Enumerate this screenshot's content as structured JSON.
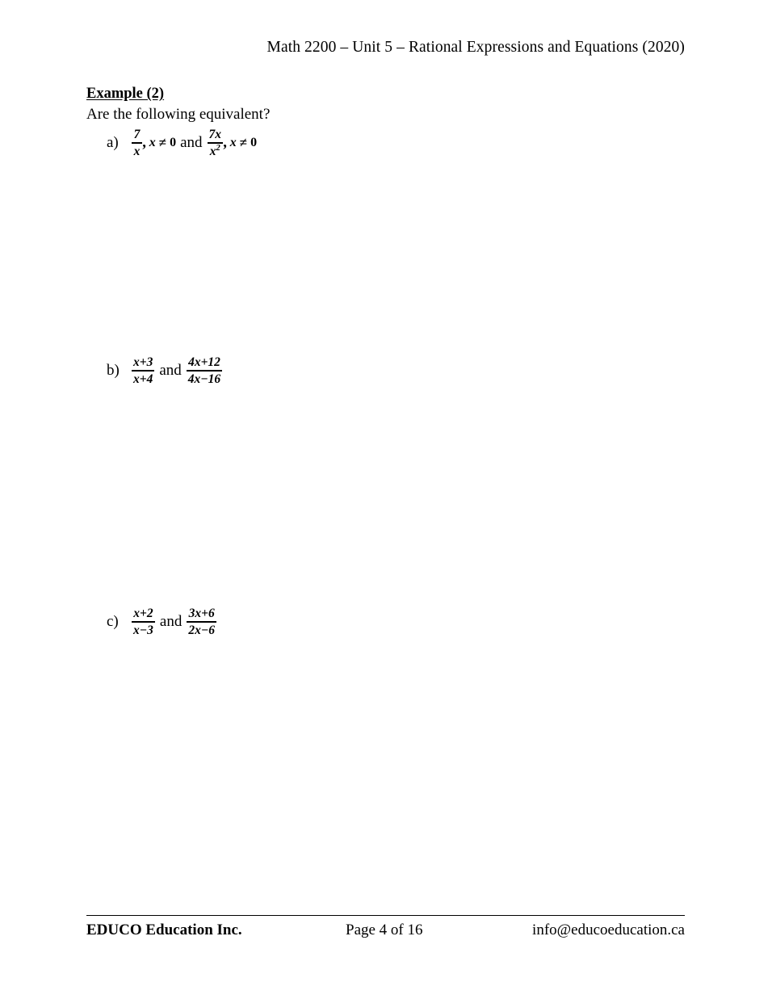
{
  "document": {
    "running_header": "Math 2200 – Unit 5 – Rational Expressions and Equations (2020)",
    "example_heading": "Example (2)",
    "prompt": "Are the following equivalent?"
  },
  "problems": [
    {
      "label": "a)",
      "text": "7/x, x ≠ 0 and 7x/x², x ≠ 0",
      "left": {
        "numerator": "7",
        "denominator": "x",
        "restriction_var": "x",
        "restriction_rel": "≠",
        "restriction_value": "0"
      },
      "connector": "and",
      "right": {
        "numerator": "7x",
        "denominator_base": "x",
        "denominator_exponent": "2",
        "restriction_var": "x",
        "restriction_rel": "≠",
        "restriction_value": "0"
      },
      "comma": ","
    },
    {
      "label": "b)",
      "text": "(x+3)/(x+4) and (4x+12)/(4x−16)",
      "left": {
        "numerator": "x+3",
        "denominator": "x+4"
      },
      "connector": "and",
      "right": {
        "numerator": "4x+12",
        "denominator": "4x−16"
      }
    },
    {
      "label": "c)",
      "text": "(x+2)/(x−3) and (3x+6)/(2x−6)",
      "left": {
        "numerator": "x+2",
        "denominator": "x−3"
      },
      "connector": "and",
      "right": {
        "numerator": "3x+6",
        "denominator": "2x−6"
      }
    }
  ],
  "footer": {
    "company": "EDUCO Education Inc.",
    "page": "Page 4 of 16",
    "email": "info@educoeducation.ca"
  },
  "colors": {
    "page_background": "#ffffff",
    "text": "#000000",
    "rule": "#000000"
  }
}
